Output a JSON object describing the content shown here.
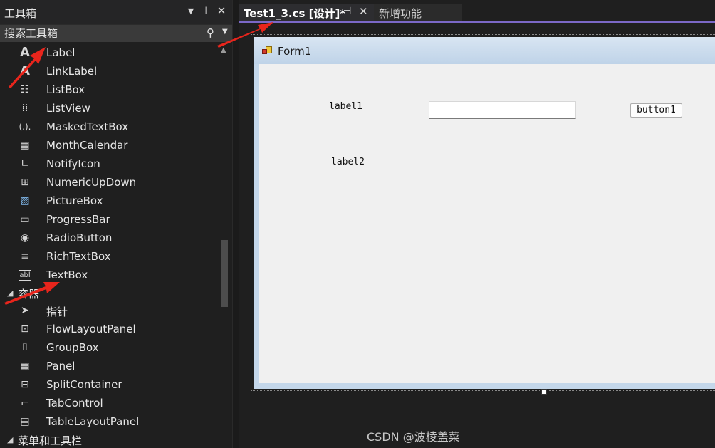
{
  "toolbox": {
    "title": "工具箱",
    "search_placeholder": "搜索工具箱",
    "items_common": [
      {
        "label": "Label",
        "icon": "label-icon"
      },
      {
        "label": "LinkLabel",
        "icon": "linklabel-icon"
      },
      {
        "label": "ListBox",
        "icon": "listbox-icon"
      },
      {
        "label": "ListView",
        "icon": "listview-icon"
      },
      {
        "label": "MaskedTextBox",
        "icon": "maskedtextbox-icon"
      },
      {
        "label": "MonthCalendar",
        "icon": "monthcalendar-icon"
      },
      {
        "label": "NotifyIcon",
        "icon": "notifyicon-icon"
      },
      {
        "label": "NumericUpDown",
        "icon": "numericupdown-icon"
      },
      {
        "label": "PictureBox",
        "icon": "picturebox-icon"
      },
      {
        "label": "ProgressBar",
        "icon": "progressbar-icon"
      },
      {
        "label": "RadioButton",
        "icon": "radiobutton-icon"
      },
      {
        "label": "RichTextBox",
        "icon": "richtextbox-icon"
      },
      {
        "label": "TextBox",
        "icon": "textbox-icon"
      }
    ],
    "group_containers": "容器",
    "items_containers": [
      {
        "label": "指针",
        "icon": "pointer-icon"
      },
      {
        "label": "FlowLayoutPanel",
        "icon": "flowlayoutpanel-icon"
      },
      {
        "label": "GroupBox",
        "icon": "groupbox-icon"
      },
      {
        "label": "Panel",
        "icon": "panel-icon"
      },
      {
        "label": "SplitContainer",
        "icon": "splitcontainer-icon"
      },
      {
        "label": "TabControl",
        "icon": "tabcontrol-icon"
      },
      {
        "label": "TableLayoutPanel",
        "icon": "tablelayoutpanel-icon"
      }
    ],
    "group_menus": "菜单和工具栏"
  },
  "tabs": {
    "active": "Test1_3.cs [设计]*",
    "inactive": "新增功能"
  },
  "form": {
    "title": "Form1",
    "label1": "label1",
    "label2": "label2",
    "textbox1_value": "",
    "button1": "button1"
  },
  "watermark": "CSDN @波棱盖菜",
  "colors": {
    "accent_tab_line": "#7b68c7",
    "annotation_arrow": "#e8251c"
  }
}
